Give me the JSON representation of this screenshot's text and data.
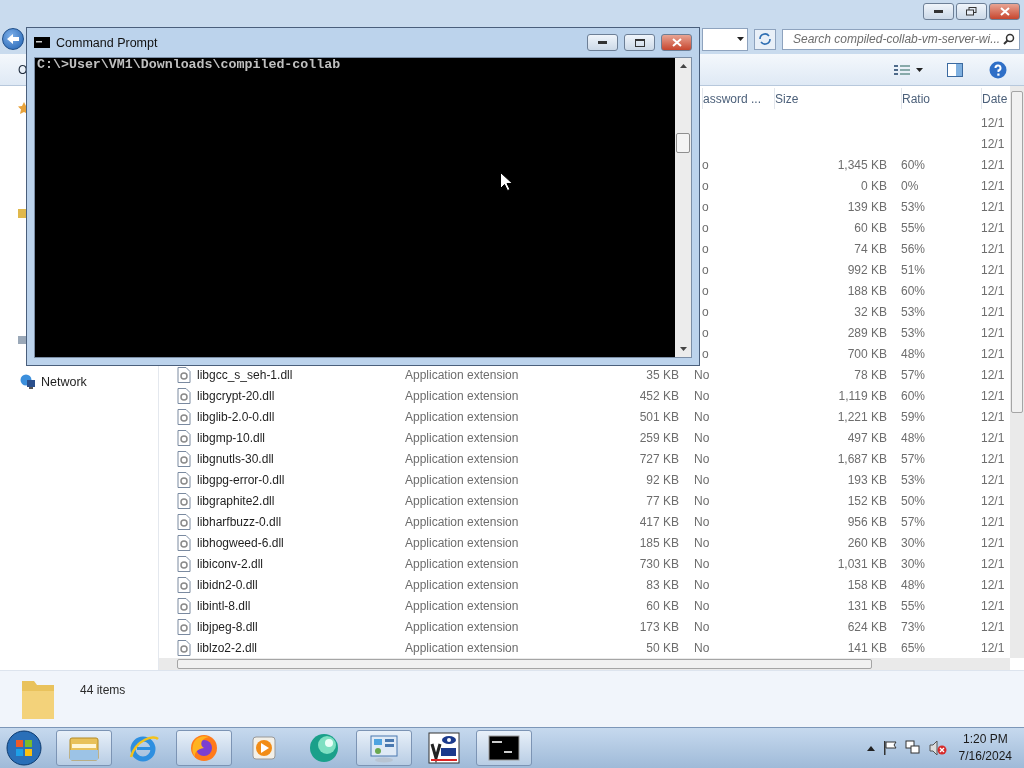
{
  "explorer": {
    "search": {
      "placeholder": "Search compiled-collab-vm-server-wi..."
    },
    "toolbar": {
      "organize": "O"
    },
    "sidebar": {
      "items": [
        {
          "label": "Network"
        }
      ]
    },
    "columns": [
      "assword ...",
      "Size",
      "Ratio",
      "Date"
    ],
    "rows": [
      {
        "date": "12/1"
      },
      {
        "date": "12/1"
      },
      {
        "password": "o",
        "compressed": "1,345 KB",
        "ratio": "60%",
        "date": "12/1"
      },
      {
        "password": "o",
        "compressed": "0 KB",
        "ratio": "0%",
        "date": "12/1"
      },
      {
        "password": "o",
        "compressed": "139 KB",
        "ratio": "53%",
        "date": "12/1"
      },
      {
        "password": "o",
        "compressed": "60 KB",
        "ratio": "55%",
        "date": "12/1"
      },
      {
        "password": "o",
        "compressed": "74 KB",
        "ratio": "56%",
        "date": "12/1"
      },
      {
        "password": "o",
        "compressed": "992 KB",
        "ratio": "51%",
        "date": "12/1"
      },
      {
        "password": "o",
        "compressed": "188 KB",
        "ratio": "60%",
        "date": "12/1"
      },
      {
        "password": "o",
        "compressed": "32 KB",
        "ratio": "53%",
        "date": "12/1"
      },
      {
        "password": "o",
        "compressed": "289 KB",
        "ratio": "53%",
        "date": "12/1"
      },
      {
        "password": "o",
        "compressed": "700 KB",
        "ratio": "48%",
        "date": "12/1"
      },
      {
        "name": "libgcc_s_seh-1.dll",
        "type": "Application extension",
        "size": "35 KB",
        "password": "No",
        "compressed": "78 KB",
        "ratio": "57%",
        "date": "12/1"
      },
      {
        "name": "libgcrypt-20.dll",
        "type": "Application extension",
        "size": "452 KB",
        "password": "No",
        "compressed": "1,119 KB",
        "ratio": "60%",
        "date": "12/1"
      },
      {
        "name": "libglib-2.0-0.dll",
        "type": "Application extension",
        "size": "501 KB",
        "password": "No",
        "compressed": "1,221 KB",
        "ratio": "59%",
        "date": "12/1"
      },
      {
        "name": "libgmp-10.dll",
        "type": "Application extension",
        "size": "259 KB",
        "password": "No",
        "compressed": "497 KB",
        "ratio": "48%",
        "date": "12/1"
      },
      {
        "name": "libgnutls-30.dll",
        "type": "Application extension",
        "size": "727 KB",
        "password": "No",
        "compressed": "1,687 KB",
        "ratio": "57%",
        "date": "12/1"
      },
      {
        "name": "libgpg-error-0.dll",
        "type": "Application extension",
        "size": "92 KB",
        "password": "No",
        "compressed": "193 KB",
        "ratio": "53%",
        "date": "12/1"
      },
      {
        "name": "libgraphite2.dll",
        "type": "Application extension",
        "size": "77 KB",
        "password": "No",
        "compressed": "152 KB",
        "ratio": "50%",
        "date": "12/1"
      },
      {
        "name": "libharfbuzz-0.dll",
        "type": "Application extension",
        "size": "417 KB",
        "password": "No",
        "compressed": "956 KB",
        "ratio": "57%",
        "date": "12/1"
      },
      {
        "name": "libhogweed-6.dll",
        "type": "Application extension",
        "size": "185 KB",
        "password": "No",
        "compressed": "260 KB",
        "ratio": "30%",
        "date": "12/1"
      },
      {
        "name": "libiconv-2.dll",
        "type": "Application extension",
        "size": "730 KB",
        "password": "No",
        "compressed": "1,031 KB",
        "ratio": "30%",
        "date": "12/1"
      },
      {
        "name": "libidn2-0.dll",
        "type": "Application extension",
        "size": "83 KB",
        "password": "No",
        "compressed": "158 KB",
        "ratio": "48%",
        "date": "12/1"
      },
      {
        "name": "libintl-8.dll",
        "type": "Application extension",
        "size": "60 KB",
        "password": "No",
        "compressed": "131 KB",
        "ratio": "55%",
        "date": "12/1"
      },
      {
        "name": "libjpeg-8.dll",
        "type": "Application extension",
        "size": "173 KB",
        "password": "No",
        "compressed": "624 KB",
        "ratio": "73%",
        "date": "12/1"
      },
      {
        "name": "liblzo2-2.dll",
        "type": "Application extension",
        "size": "50 KB",
        "password": "No",
        "compressed": "141 KB",
        "ratio": "65%",
        "date": "12/1"
      }
    ],
    "status": {
      "count": "44 items"
    }
  },
  "command_prompt": {
    "title": "Command Prompt",
    "lines": [
      "C:\\>User\\VM1\\Downloads\\compiled-collab"
    ]
  },
  "taskbar": {
    "apps": [
      {
        "kind": "explorer",
        "running": true
      },
      {
        "kind": "ie",
        "running": false
      },
      {
        "kind": "firefox",
        "running": true
      },
      {
        "kind": "media",
        "running": false
      },
      {
        "kind": "orb",
        "running": false
      },
      {
        "kind": "panel",
        "running": true
      },
      {
        "kind": "vnc",
        "running": false
      },
      {
        "kind": "cmd",
        "running": true
      }
    ],
    "clock": {
      "time": "1:20 PM",
      "date": "7/16/2024"
    }
  }
}
